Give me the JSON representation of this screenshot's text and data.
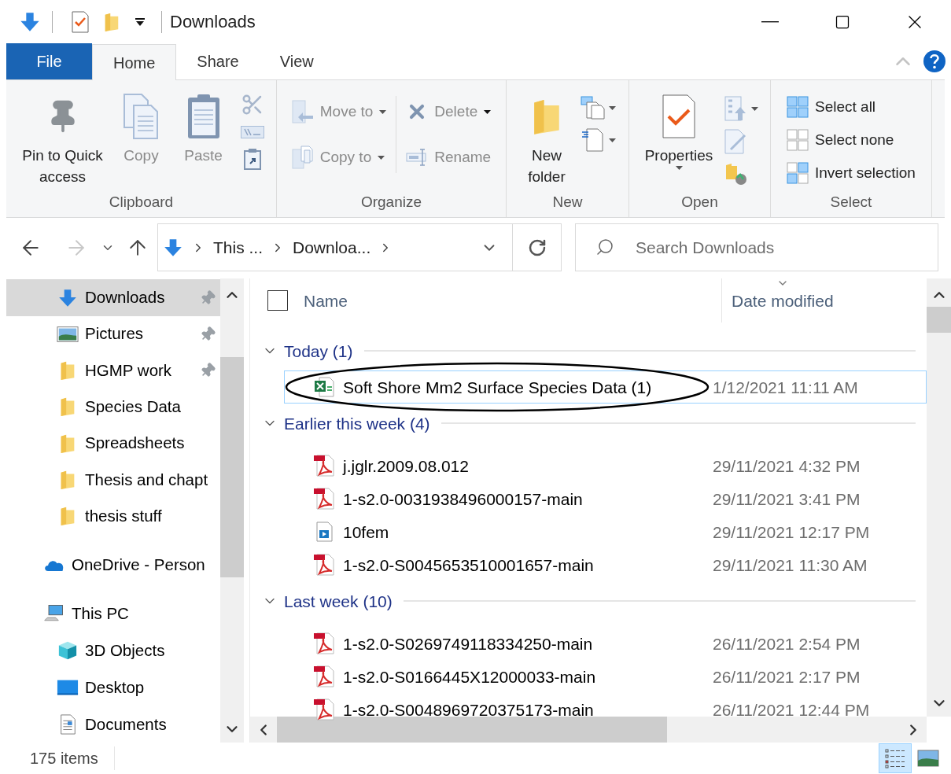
{
  "window": {
    "title": "Downloads"
  },
  "ribbon": {
    "file_tab": "File",
    "tabs": [
      {
        "label": "Home",
        "selected": true
      },
      {
        "label": "Share",
        "selected": false
      },
      {
        "label": "View",
        "selected": false
      }
    ],
    "groups": [
      {
        "label": "Clipboard",
        "commands": [
          {
            "label": "Pin to Quick access",
            "disabled": false
          },
          {
            "label": "Copy",
            "disabled": true
          },
          {
            "label": "Paste",
            "disabled": true
          }
        ]
      },
      {
        "label": "Organize",
        "commands": [
          {
            "label": "Move to",
            "disabled": true
          },
          {
            "label": "Copy to",
            "disabled": true
          },
          {
            "label": "Delete",
            "disabled": true
          },
          {
            "label": "Rename",
            "disabled": true
          }
        ]
      },
      {
        "label": "New",
        "commands": [
          {
            "label": "New folder",
            "disabled": false
          }
        ]
      },
      {
        "label": "Open",
        "commands": [
          {
            "label": "Properties",
            "disabled": false
          }
        ]
      },
      {
        "label": "Select",
        "commands": [
          {
            "label": "Select all",
            "disabled": false
          },
          {
            "label": "Select none",
            "disabled": false
          },
          {
            "label": "Invert selection",
            "disabled": false
          }
        ]
      }
    ]
  },
  "address": {
    "segments": [
      "This ...",
      "Downloa..."
    ]
  },
  "search": {
    "placeholder": "Search Downloads"
  },
  "sidebar": {
    "quick_access": [
      {
        "label": "Downloads",
        "kind": "downloads",
        "pinned": true,
        "selected": true
      },
      {
        "label": "Pictures",
        "kind": "pictures",
        "pinned": true,
        "selected": false
      },
      {
        "label": "HGMP work",
        "kind": "folder",
        "pinned": true,
        "selected": false
      },
      {
        "label": "Species Data",
        "kind": "folder",
        "pinned": false,
        "selected": false
      },
      {
        "label": "Spreadsheets",
        "kind": "folder",
        "pinned": false,
        "selected": false
      },
      {
        "label": "Thesis and chapt",
        "kind": "folder",
        "pinned": false,
        "selected": false
      },
      {
        "label": "thesis stuff",
        "kind": "folder",
        "pinned": false,
        "selected": false
      }
    ],
    "tree": [
      {
        "label": "OneDrive - Person",
        "kind": "cloud"
      },
      {
        "label": "This PC",
        "kind": "pc",
        "children": [
          {
            "label": "3D Objects",
            "kind": "cube"
          },
          {
            "label": "Desktop",
            "kind": "desktop"
          },
          {
            "label": "Documents",
            "kind": "documents"
          }
        ]
      }
    ]
  },
  "file_list": {
    "select_all_checked": false,
    "columns": [
      {
        "label": "Name",
        "sorted": false
      },
      {
        "label": "Date modified",
        "sorted": true
      }
    ],
    "groups": [
      {
        "label": "Today (1)",
        "expanded": true,
        "files": [
          {
            "name": "Soft Shore Mm2 Surface Species Data (1)",
            "date": "1/12/2021 11:11 AM",
            "kind": "excel",
            "selected": true,
            "circled": true
          }
        ]
      },
      {
        "label": "Earlier this week (4)",
        "expanded": true,
        "files": [
          {
            "name": "j.jglr.2009.08.012",
            "date": "29/11/2021 4:32 PM",
            "kind": "pdf",
            "selected": false,
            "circled": false
          },
          {
            "name": "1-s2.0-0031938496000157-main",
            "date": "29/11/2021 3:41 PM",
            "kind": "pdf",
            "selected": false,
            "circled": false
          },
          {
            "name": "10fem",
            "date": "29/11/2021 12:17 PM",
            "kind": "media",
            "selected": false,
            "circled": false
          },
          {
            "name": "1-s2.0-S0045653510001657-main",
            "date": "29/11/2021 11:30 AM",
            "kind": "pdf",
            "selected": false,
            "circled": false
          }
        ]
      },
      {
        "label": "Last week (10)",
        "expanded": true,
        "files": [
          {
            "name": "1-s2.0-S0269749118334250-main",
            "date": "26/11/2021 2:54 PM",
            "kind": "pdf",
            "selected": false,
            "circled": false
          },
          {
            "name": "1-s2.0-S0166445X12000033-main",
            "date": "26/11/2021 2:17 PM",
            "kind": "pdf",
            "selected": false,
            "circled": false
          },
          {
            "name": "1-s2.0-S0048969720375173-main",
            "date": "26/11/2021 12:44 PM",
            "kind": "pdf",
            "selected": false,
            "circled": false
          }
        ]
      }
    ]
  },
  "status_bar": {
    "item_count": "175 items",
    "views": [
      {
        "kind": "details",
        "selected": true
      },
      {
        "kind": "large_icons",
        "selected": false
      }
    ]
  }
}
